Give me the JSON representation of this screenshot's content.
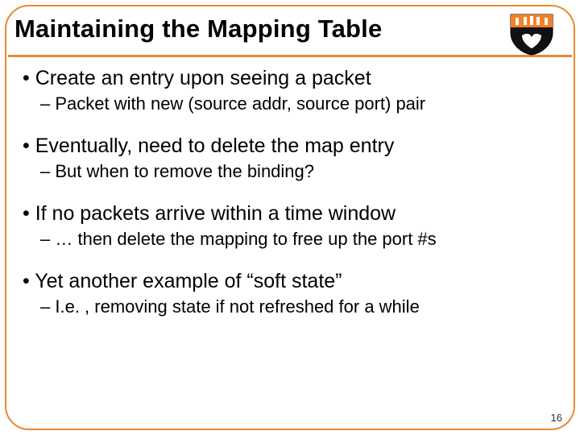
{
  "title": "Maintaining the Mapping Table",
  "points": [
    {
      "main": "Create an entry upon seeing a packet",
      "sub": "Packet with new (source addr, source port) pair"
    },
    {
      "main": "Eventually, need to delete the map entry",
      "sub": "But when to remove the binding?"
    },
    {
      "main": "If no packets arrive within a time window",
      "sub": "… then delete the mapping to free up the port #s"
    },
    {
      "main": "Yet another example of “soft state”",
      "sub": "I.e. , removing state if not refreshed for a while"
    }
  ],
  "page_number": "16",
  "logo_name": "princeton-shield"
}
